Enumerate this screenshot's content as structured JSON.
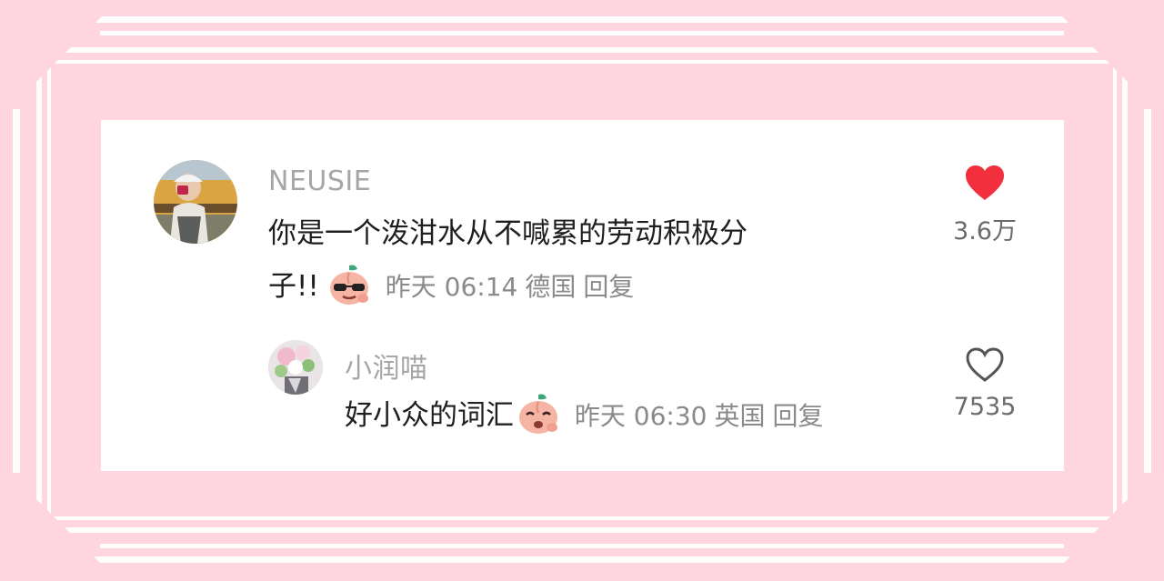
{
  "colors": {
    "background": "#ffd6df",
    "frame": "#ffffff",
    "like_active": "#f22f3c",
    "like_inactive": "#555555"
  },
  "comments": [
    {
      "username": "NEUSIE",
      "text_line1": "你是一个泼泔水从不喊累的劳动积极分",
      "text_line2": "子!!",
      "emoji": "cool-peach-emoji",
      "time": "昨天 06:14",
      "location": "德国",
      "reply_label": "回复",
      "likes": "3.6万",
      "liked": true
    },
    {
      "username": "小润喵",
      "text_line1": "好小众的词汇",
      "emoji": "laughing-peach-emoji",
      "time": "昨天 06:30",
      "location": "英国",
      "reply_label": "回复",
      "likes": "7535",
      "liked": false
    }
  ]
}
